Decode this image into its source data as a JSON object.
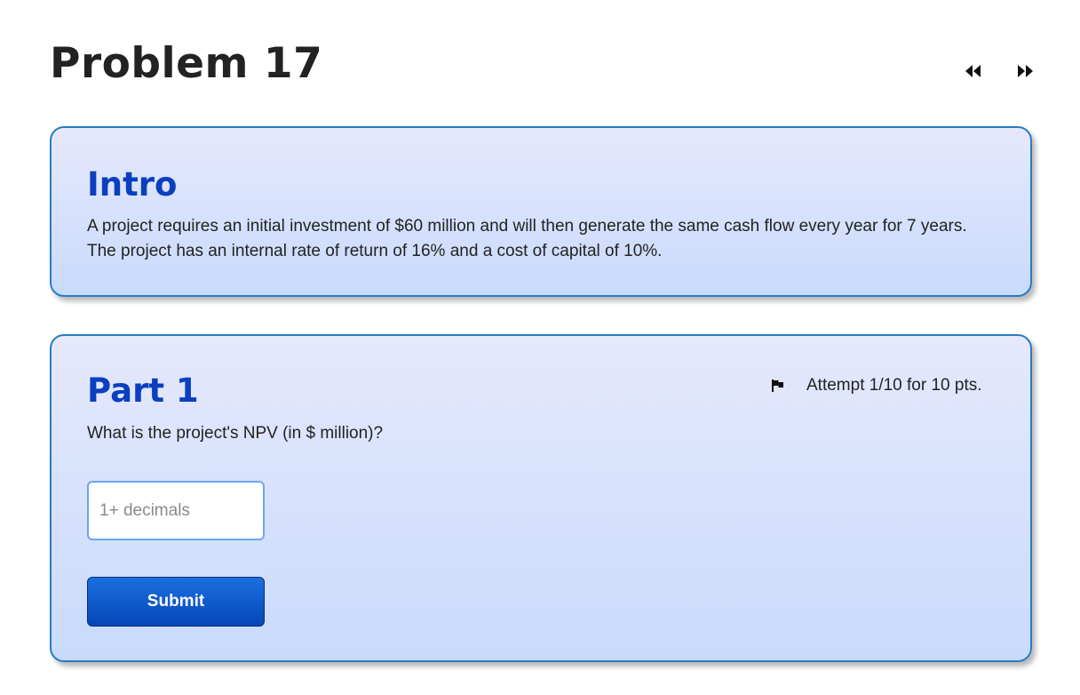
{
  "page": {
    "title": "Problem 17"
  },
  "nav": {
    "prev_icon": "rewind-icon",
    "next_icon": "fast-forward-icon"
  },
  "intro": {
    "heading": "Intro",
    "text": "A project requires an initial investment of $60 million and will then generate the same cash flow every year for 7 years. The project has an internal rate of return of 16% and a cost of capital of 10%."
  },
  "part1": {
    "heading": "Part 1",
    "attempt_text": "Attempt 1/10 for 10 pts.",
    "flag_icon": "flag-icon",
    "question": "What is the project's NPV (in $ million)?",
    "input_value": "",
    "input_placeholder": "1+ decimals",
    "submit_label": "Submit"
  },
  "colors": {
    "heading_blue": "#0a3fbf",
    "card_border": "#2a7bc2",
    "card_bg_top": "#e6e8fc",
    "card_bg_bottom": "#c8dbfb",
    "submit_bg": "#0646b8"
  }
}
